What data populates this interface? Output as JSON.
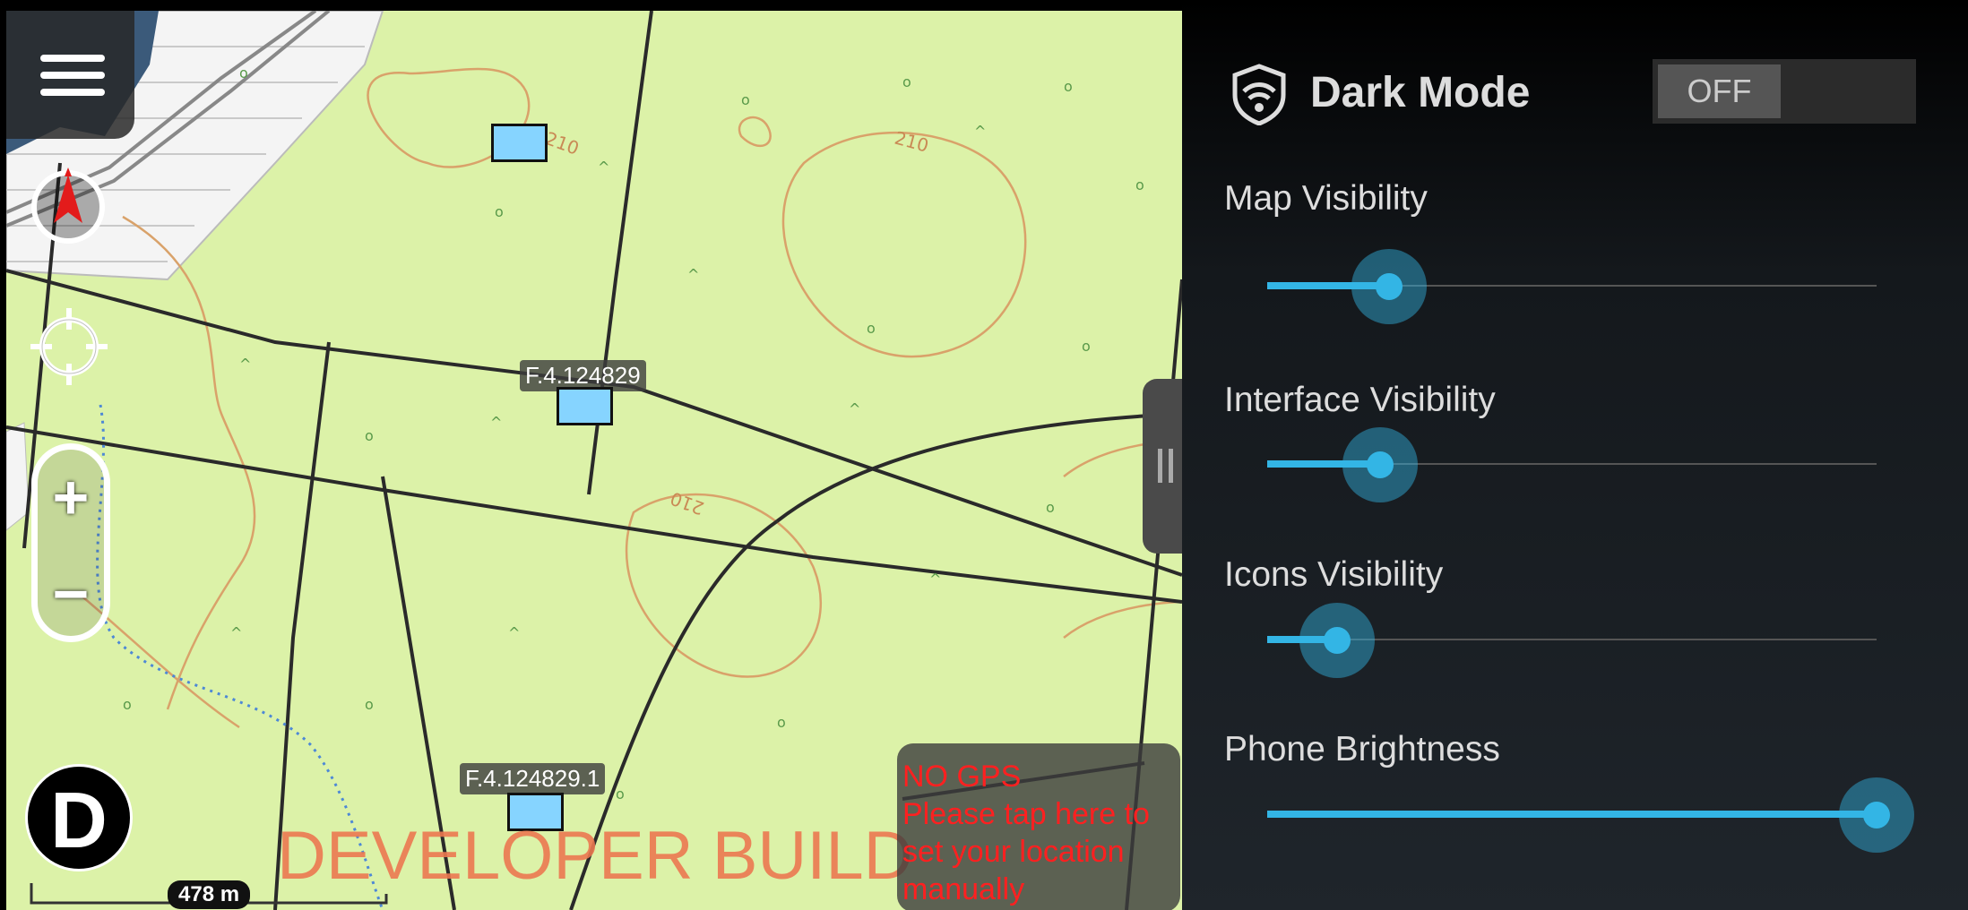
{
  "map": {
    "parcels": [
      {
        "label": ""
      },
      {
        "label": "F.4.124829"
      },
      {
        "label": "F.4.124829.1"
      }
    ],
    "watermark": "DEVELOPER BUILD",
    "gps_notice": {
      "line1": "NO GPS",
      "line2": "Please tap here to set your location manually"
    },
    "scale_label": "478 m",
    "contour_labels": [
      "210",
      "210",
      "210"
    ],
    "logo_letter": "D",
    "colors": {
      "map_bg": "#dcf2a8",
      "parcel_fill": "#86d4ff",
      "contour": "#d9a26a",
      "road": "#2a2a2a"
    },
    "icons": [
      "menu-icon",
      "compass-icon",
      "locate-crosshair-icon",
      "zoom-in-icon",
      "zoom-out-icon",
      "drawer-handle-icon"
    ]
  },
  "panel": {
    "dark_mode": {
      "title": "Dark Mode",
      "toggle_label": "OFF",
      "icon": "wifi-shield-icon"
    },
    "sliders": [
      {
        "label": "Map Visibility",
        "value": 0.2
      },
      {
        "label": "Interface Visibility",
        "value": 0.185
      },
      {
        "label": "Icons Visibility",
        "value": 0.115
      },
      {
        "label": "Phone Brightness",
        "value": 1.0
      }
    ],
    "accent": "#33b5e5"
  }
}
